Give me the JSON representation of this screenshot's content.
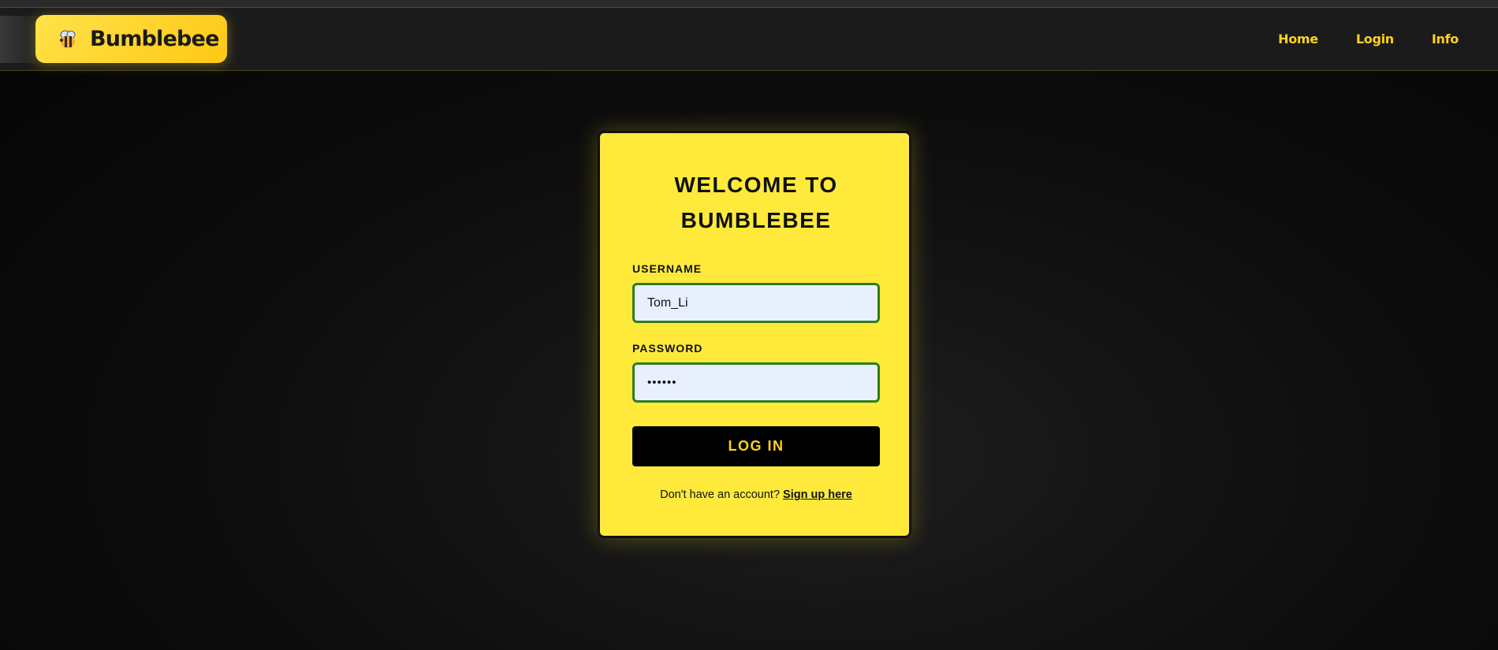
{
  "navbar": {
    "brand": "Bumblebee",
    "brand_icon": "bee-icon",
    "links": [
      {
        "label": "Home"
      },
      {
        "label": "Login"
      },
      {
        "label": "Info"
      }
    ]
  },
  "login_card": {
    "title": "WELCOME TO BUMBLEBEE",
    "username_label": "USERNAME",
    "username_value": "Tom_Li",
    "password_label": "PASSWORD",
    "password_value": "••••••",
    "submit_label": "LOG IN",
    "signup_prompt": "Don't have an account?",
    "signup_link": "Sign up here"
  },
  "colors": {
    "accent_yellow": "#ffea3c",
    "nav_link": "#ffd21e",
    "field_border": "#2e7d1e",
    "field_bg": "#e8f0fe",
    "button_bg": "#000000"
  }
}
